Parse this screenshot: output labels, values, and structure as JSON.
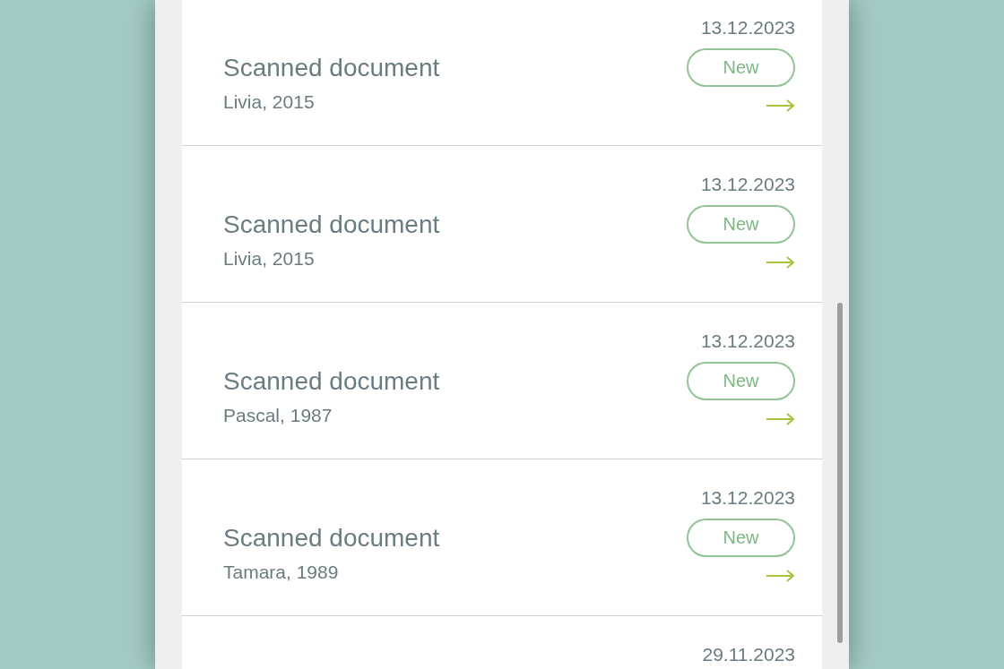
{
  "documents": [
    {
      "title": "Scanned document",
      "subtitle": "Livia, 2015",
      "date": "13.12.2023",
      "badge": "New"
    },
    {
      "title": "Scanned document",
      "subtitle": "Livia, 2015",
      "date": "13.12.2023",
      "badge": "New"
    },
    {
      "title": "Scanned document",
      "subtitle": "Pascal, 1987",
      "date": "13.12.2023",
      "badge": "New"
    },
    {
      "title": "Scanned document",
      "subtitle": "Tamara, 1989",
      "date": "13.12.2023",
      "badge": "New"
    },
    {
      "date": "29.11.2023"
    }
  ]
}
